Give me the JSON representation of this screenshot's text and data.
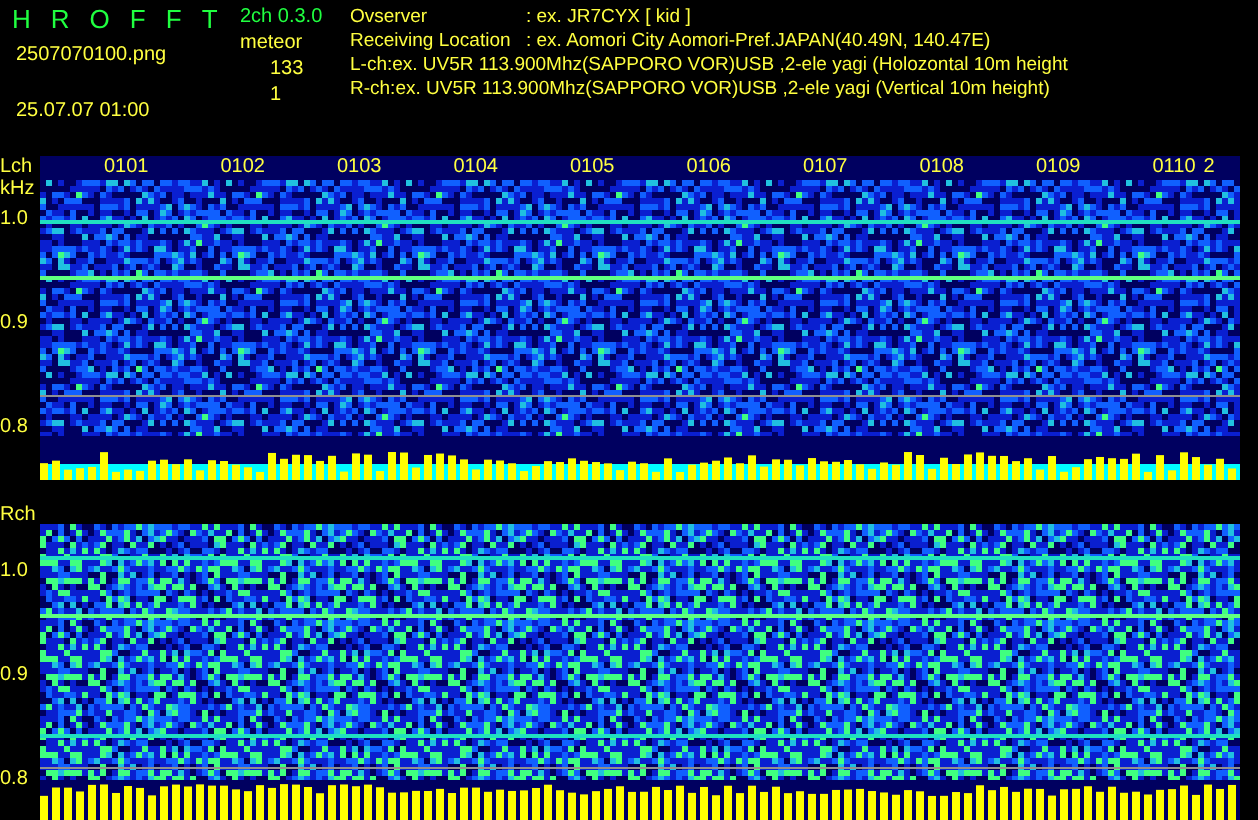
{
  "app": {
    "title_letters": [
      "H",
      "R",
      "O",
      "F",
      "F",
      "T"
    ],
    "version": "2ch 0.3.0",
    "filename": "2507070100.png",
    "datetime": "25.07.07 01:00",
    "meteor_label": "meteor",
    "meteor_counts": [
      "133",
      "1"
    ]
  },
  "info": [
    {
      "kind": "pair",
      "label": "Ovserver",
      "value": ": ex. JR7CYX [ kid ]"
    },
    {
      "kind": "pair",
      "label": "Receiving Location",
      "value": ": ex. Aomori City Aomori-Pref.JAPAN(40.49N, 140.47E)"
    },
    {
      "kind": "line",
      "value": "L-ch:ex. UV5R 113.900Mhz(SAPPORO VOR)USB ,2-ele yagi (Holozontal 10m height"
    },
    {
      "kind": "line",
      "value": "R-ch:ex. UV5R 113.900Mhz(SAPPORO VOR)USB ,2-ele yagi (Vertical 10m height)"
    }
  ],
  "time_labels": [
    "0101",
    "0102",
    "0103",
    "0104",
    "0105",
    "0106",
    "0107",
    "0108",
    "0109",
    "0110",
    "2"
  ],
  "panels": [
    {
      "label": "Lch",
      "unit": "kHz",
      "ticks": [
        "1.0",
        "0.9",
        "0.8"
      ]
    },
    {
      "label": "Rch",
      "ticks": [
        "1.0",
        "0.9",
        "0.8"
      ]
    }
  ]
}
